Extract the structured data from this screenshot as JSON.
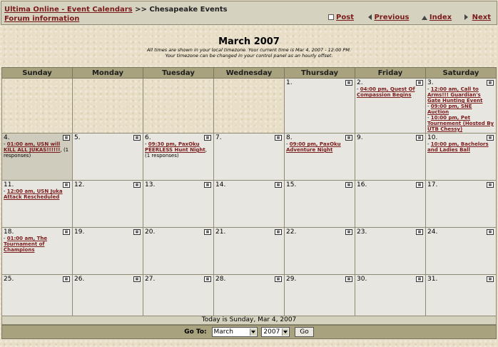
{
  "header": {
    "crumb_link": "Ultima Online - Event Calendars",
    "crumb_sep": ">>",
    "crumb_current": "Chesapeake Events",
    "forum_link": "Forum information",
    "nav": {
      "post": "Post",
      "previous": "Previous",
      "index": "Index",
      "next": "Next"
    }
  },
  "calendar": {
    "title": "March 2007",
    "tz_line1": "All times are shown in your local timezone. Your current time is Mar 4, 2007 - 12:00 PM.",
    "tz_line2": "Your timezone can be changed in your control panel as an hourly offset.",
    "weekdays": [
      "Sunday",
      "Monday",
      "Tuesday",
      "Wednesday",
      "Thursday",
      "Friday",
      "Saturday"
    ],
    "weeks": [
      [
        {
          "day": ""
        },
        {
          "day": ""
        },
        {
          "day": ""
        },
        {
          "day": ""
        },
        {
          "day": "1."
        },
        {
          "day": "2.",
          "events": [
            {
              "text": "04:00 pm, Quest Of Compassion Begins"
            }
          ]
        },
        {
          "day": "3.",
          "events": [
            {
              "text": "12:00 am, Call to Arms!!! Guardian's Gate Hunting Event"
            },
            {
              "text": "09:00 pm, SNE Auction"
            },
            {
              "text": "10:00 pm, Pet Tournement (Hosted By UTB Chessy)"
            }
          ]
        }
      ],
      [
        {
          "day": "4.",
          "today": true,
          "events": [
            {
              "text": "01:00 am, USN will KILL ALL JUKAS!!!!!!",
              "extra": ", (1 responses)"
            }
          ]
        },
        {
          "day": "5."
        },
        {
          "day": "6.",
          "events": [
            {
              "text": "09:30 pm, PaxOku PEERLESS Hunt Night",
              "extra": ", (1 responses)"
            }
          ]
        },
        {
          "day": "7."
        },
        {
          "day": "8.",
          "events": [
            {
              "text": "09:00 pm, PaxOku Adventure Night"
            }
          ]
        },
        {
          "day": "9."
        },
        {
          "day": "10.",
          "events": [
            {
              "text": "10:00 pm, Bachelors and Ladies Ball"
            }
          ]
        }
      ],
      [
        {
          "day": "11.",
          "events": [
            {
              "text": "12:00 am, USN Juka Attack Rescheduled"
            }
          ]
        },
        {
          "day": "12."
        },
        {
          "day": "13."
        },
        {
          "day": "14."
        },
        {
          "day": "15."
        },
        {
          "day": "16."
        },
        {
          "day": "17."
        }
      ],
      [
        {
          "day": "18.",
          "events": [
            {
              "text": "01:00 am, The Tournament of Champions"
            }
          ]
        },
        {
          "day": "19."
        },
        {
          "day": "20."
        },
        {
          "day": "21."
        },
        {
          "day": "22."
        },
        {
          "day": "23."
        },
        {
          "day": "24."
        }
      ],
      [
        {
          "day": "25."
        },
        {
          "day": "26."
        },
        {
          "day": "27."
        },
        {
          "day": "28."
        },
        {
          "day": "29."
        },
        {
          "day": "30."
        },
        {
          "day": "31."
        }
      ]
    ]
  },
  "footer": {
    "today_text": "Today is Sunday, Mar 4, 2007",
    "goto_label": "Go To:",
    "month_value": "March",
    "year_value": "2007",
    "go_button": "Go"
  }
}
